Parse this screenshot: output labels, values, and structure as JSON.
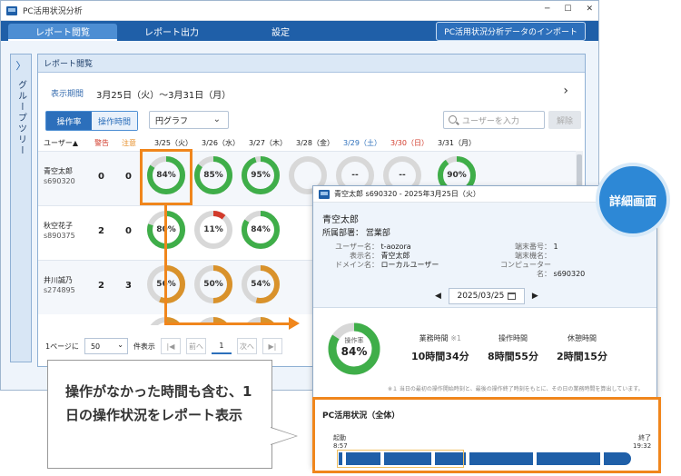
{
  "window": {
    "title": "PC活用状況分析"
  },
  "menu": {
    "items": [
      "レポート閲覧",
      "レポート出力",
      "設定"
    ],
    "import_label": "PC活用状況分析データのインポート"
  },
  "sidebar": {
    "label": "グループツリー",
    "toggle": "〉"
  },
  "panel": {
    "title": "レポート閲覧",
    "period_label": "表示期間",
    "period_value": "3月25日（火）～3月31日（月）",
    "next": "›"
  },
  "tabs": [
    "操作率",
    "操作時間"
  ],
  "chart_type_select": "円グラフ",
  "search": {
    "placeholder": "ユーザーを入力",
    "clear_label": "解除"
  },
  "table": {
    "user_header": "ユーザー▲",
    "warn_header": "警告",
    "note_header": "注意",
    "dates": [
      "3/25（火）",
      "3/26（水）",
      "3/27（木）",
      "3/28（金）",
      "3/29（土）",
      "3/30（日）",
      "3/31（月）"
    ],
    "rows": [
      {
        "name": "青空太郎",
        "id": "s690320",
        "warn": "0",
        "note": "0",
        "cells": [
          {
            "v": 84,
            "label": "84%"
          },
          {
            "v": 85,
            "label": "85%"
          },
          {
            "v": 95,
            "label": "95%"
          },
          {
            "v": 0,
            "label": ""
          },
          {
            "v": 0,
            "label": "--"
          },
          {
            "v": 0,
            "label": "--"
          },
          {
            "v": 90,
            "label": "90%"
          }
        ]
      },
      {
        "name": "秋空花子",
        "id": "s890375",
        "warn": "2",
        "note": "0",
        "cells": [
          {
            "v": 80,
            "label": "80%"
          },
          {
            "v": 11,
            "label": "11%"
          },
          {
            "v": 84,
            "label": "84%"
          }
        ]
      },
      {
        "name": "井川誠乃",
        "id": "s274895",
        "warn": "2",
        "note": "3",
        "cells": [
          {
            "v": 56,
            "label": "56%"
          },
          {
            "v": 50,
            "label": "50%"
          },
          {
            "v": 54,
            "label": "54%"
          }
        ]
      }
    ]
  },
  "pager": {
    "prefix": "1ページに",
    "per_page": "50",
    "suffix": "件表示",
    "first": "|◀",
    "prev": "前へ",
    "current": "1",
    "next": "次へ",
    "last": "▶|"
  },
  "detail": {
    "title": "青空太郎 s690320 - 2025年3月25日（火）",
    "name": "青空太郎",
    "dept_label": "所属部署：",
    "dept": "営業部",
    "user_name_label": "ユーザー名：",
    "user_name": "t-aozora",
    "display_name_label": "表示名：",
    "display_name": "青空太郎",
    "domain_label": "ドメイン名：",
    "domain": "ローカルユーザー",
    "terminal_no_label": "端末番号：",
    "terminal_no": "1",
    "terminal_name_label": "端末機名：",
    "terminal_name": "",
    "computer_label": "コンピューター名：",
    "computer": "s690320",
    "date": "2025/03/25",
    "rate_label": "操作率",
    "rate_value": "84%",
    "rate_pct": 84,
    "work_label": "業務時間",
    "work_note": "※1",
    "work_value": "10時間34分",
    "op_label": "操作時間",
    "op_value": "8時間55分",
    "rest_label": "休憩時間",
    "rest_value": "2時間15分",
    "footnote": "※１ 当日の最初の操作開始時刻と、最後の操作終了時刻をもとに、その日の業務時間を算出しています。"
  },
  "overview": {
    "title": "PC活用状況（全体）",
    "start_label": "起動",
    "start_time": "8:57",
    "end_label": "終了",
    "end_time": "19:32"
  },
  "callout": {
    "badge": "詳細画面",
    "text": "操作がなかった時間も含む、1日の操作状況をレポート表示"
  },
  "colors": {
    "green": "#3fae49",
    "red": "#d23a2a",
    "orange": "#d9922b",
    "gray": "#d8d8d8",
    "accent": "#f0861c",
    "blue": "#1f5fa8"
  }
}
